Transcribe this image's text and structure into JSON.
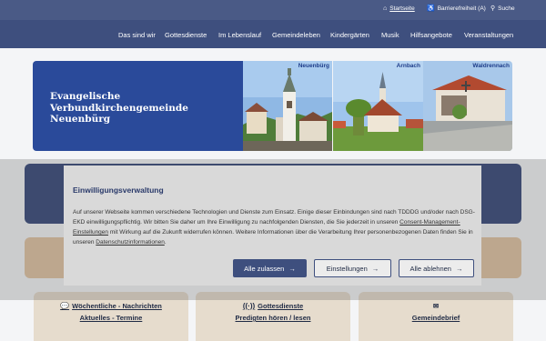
{
  "utility": {
    "start": "Startseite",
    "accessibility": "Barrierefreiheit (A)",
    "search": "Suche"
  },
  "nav": {
    "items": [
      "Das sind wir",
      "Gottesdienste",
      "Im Lebenslauf",
      "Gemeindeleben",
      "Kindergärten",
      "Musik",
      "Hilfsangebote",
      "Veranstaltungen"
    ]
  },
  "banner": {
    "title": "Evangelische Verbundkirchengemeinde Neuenbürg",
    "places": [
      "Neuenbürg",
      "Arnbach",
      "Waldrennach"
    ]
  },
  "consent": {
    "title": "Einwilligungsverwaltung",
    "text_1": "Auf unserer Webseite kommen verschiedene Technologien und Dienste zum Einsatz. Einige dieser Einbindungen sind nach TDDDG und/oder nach DSG-EKD einwilligungspflichtig. Wir bitten Sie daher um Ihre Einwilligung zu nachfolgenden Diensten, die Sie jederzeit in unseren ",
    "link_1": "Consent-Management-Einstellungen",
    "text_2": " mit Wirkung auf die Zukunft widerrufen können. Weitere Informationen über die Verarbeitung Ihrer personenbezogenen Daten finden Sie in unseren ",
    "link_2": "Datenschutzinformationen",
    "text_3": ".",
    "accept_all": "Alle zulassen",
    "settings": "Einstellungen",
    "reject_all": "Alle ablehnen"
  },
  "cards": [
    {
      "line1": "Wöchentliche - Nachrichten",
      "line2": "Aktuelles - Termine",
      "icon": "chat-icon"
    },
    {
      "line1": "Gottesdienste",
      "line2": "Predigten hören / lesen",
      "icon": "broadcast-icon"
    },
    {
      "line1": "",
      "line2": "Gemeindebrief",
      "icon": "envelope-icon"
    }
  ],
  "colors": {
    "nav": "#3e4f7e",
    "banner": "#2a4a9a",
    "card": "#e6dccd"
  }
}
